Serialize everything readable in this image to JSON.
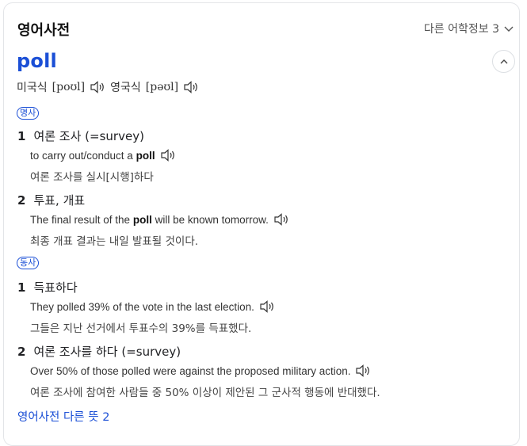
{
  "header": {
    "title": "영어사전",
    "more_info": "다른 어학정보 3"
  },
  "entry": {
    "word": "poll",
    "pron_us_label": "미국식",
    "pron_us": "[poʊl]",
    "pron_uk_label": "영국식",
    "pron_uk": "[pəʊl]"
  },
  "noun": {
    "pos": "명사",
    "senses": [
      {
        "num": "1",
        "meaning": "여론 조사 (=survey)",
        "ex_pre": "to carry out/conduct a ",
        "ex_bold": "poll",
        "ex_post": "",
        "tr": "여론 조사를 실시[시행]하다"
      },
      {
        "num": "2",
        "meaning": "투표, 개표",
        "ex_pre": "The final result of the ",
        "ex_bold": "poll",
        "ex_post": " will be known tomorrow.",
        "tr": "최종 개표 결과는 내일 발표될 것이다."
      }
    ]
  },
  "verb": {
    "pos": "동사",
    "senses": [
      {
        "num": "1",
        "meaning": "득표하다",
        "ex": "They polled 39% of the vote in the last election.",
        "tr": "그들은 지난 선거에서 투표수의 39%를 득표했다."
      },
      {
        "num": "2",
        "meaning": "여론 조사를 하다 (=survey)",
        "ex": "Over 50% of those polled were against the proposed military action.",
        "tr": "여론 조사에 참여한 사람들 중 50% 이상이 제안된 그 군사적 행동에 반대했다."
      }
    ]
  },
  "footer": {
    "more_link": "영어사전 다른 뜻 2"
  },
  "colors": {
    "accent": "#1b4fd6",
    "text": "#202124"
  },
  "icons": [
    "chevron-down-icon",
    "chevron-up-icon",
    "speaker-icon"
  ]
}
